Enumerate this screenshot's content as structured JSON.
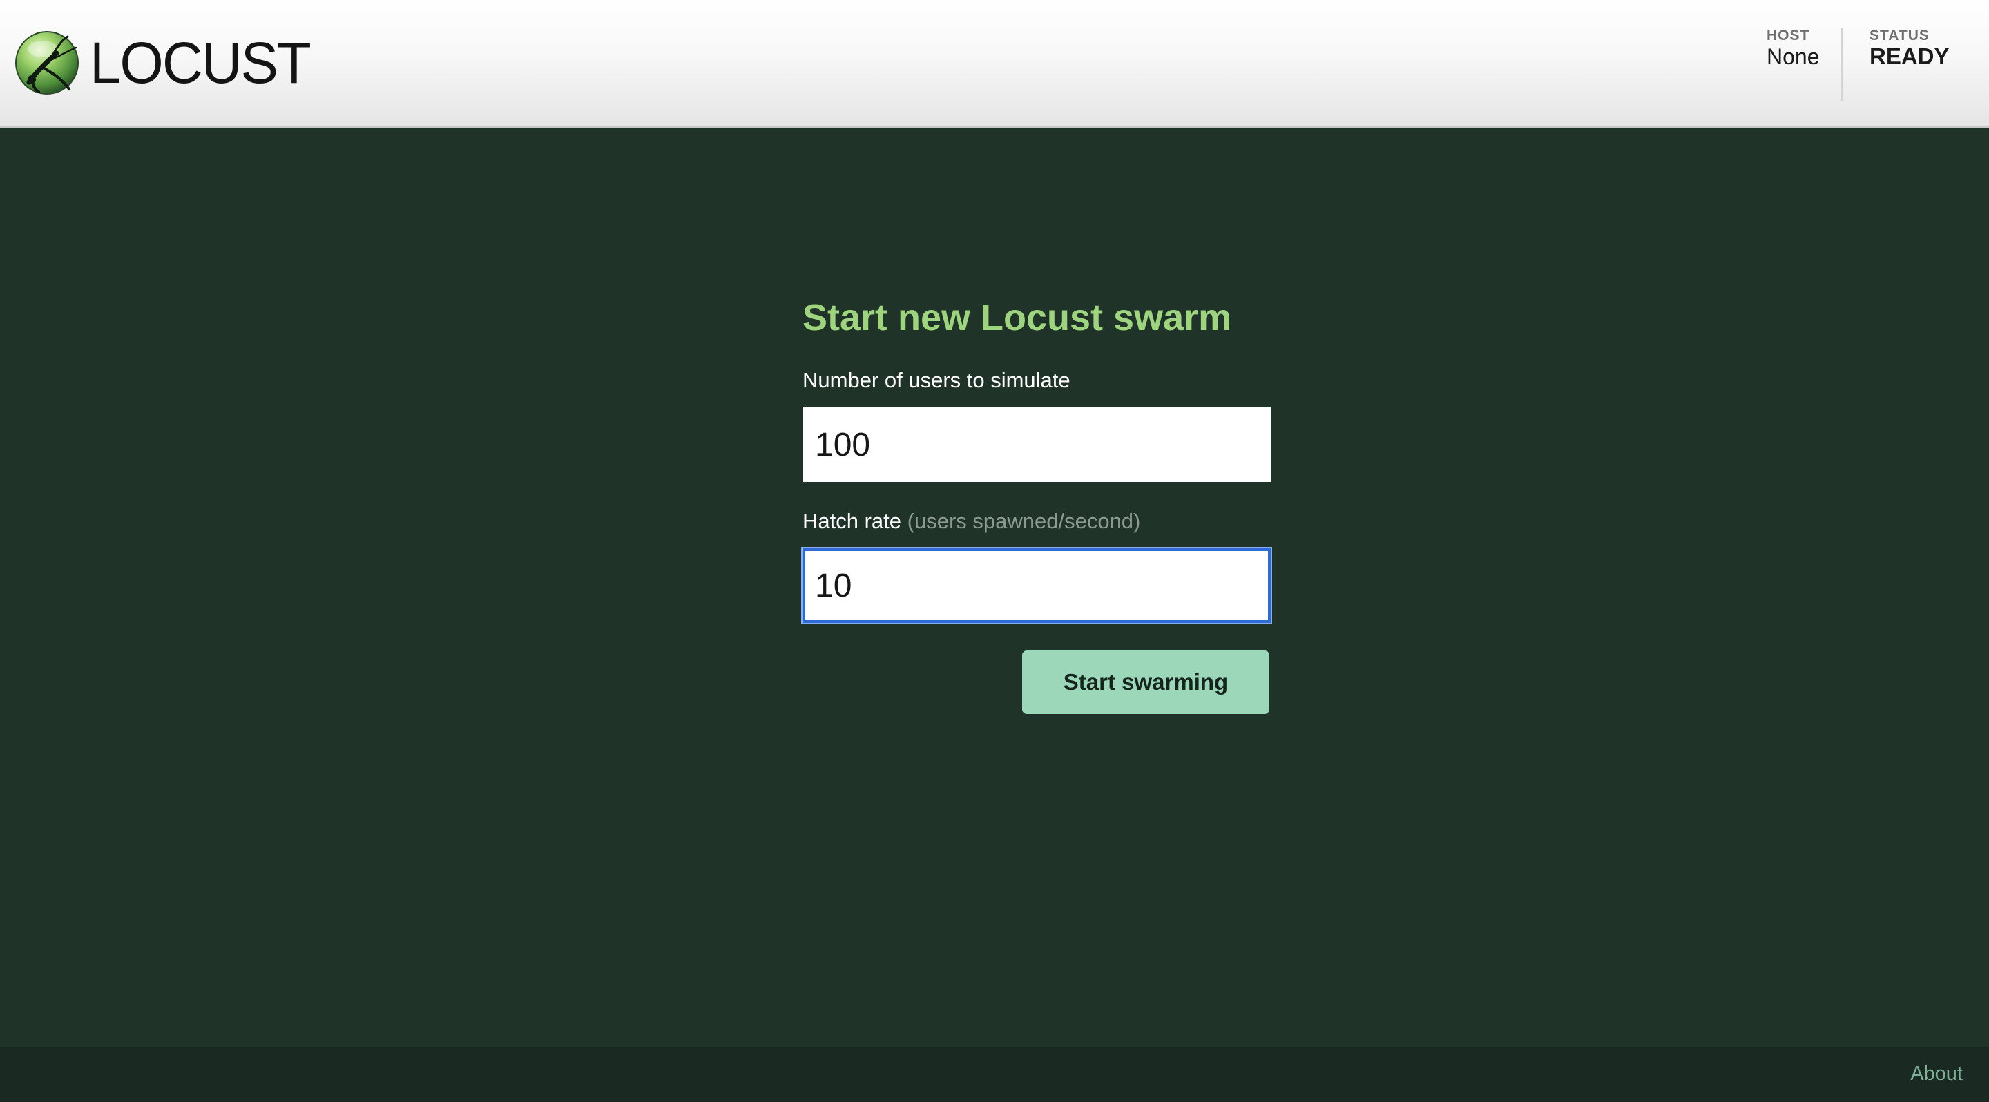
{
  "header": {
    "logo_text": "LOCUST",
    "host": {
      "label": "HOST",
      "value": "None"
    },
    "status": {
      "label": "STATUS",
      "value": "READY"
    }
  },
  "form": {
    "title": "Start new Locust swarm",
    "users": {
      "label": "Number of users to simulate",
      "value": "100"
    },
    "hatch_rate": {
      "label": "Hatch rate",
      "hint": "(users spawned/second)",
      "value": "10"
    },
    "submit_label": "Start swarming"
  },
  "footer": {
    "about_label": "About"
  },
  "colors": {
    "background": "#1f3329",
    "title": "#9fd47e",
    "button": "#9cd7b9",
    "focus_ring": "#2e6bd6",
    "footer": "#1b2923",
    "link": "#7fae96"
  },
  "icons": {
    "logo": "locust-logo-icon"
  }
}
